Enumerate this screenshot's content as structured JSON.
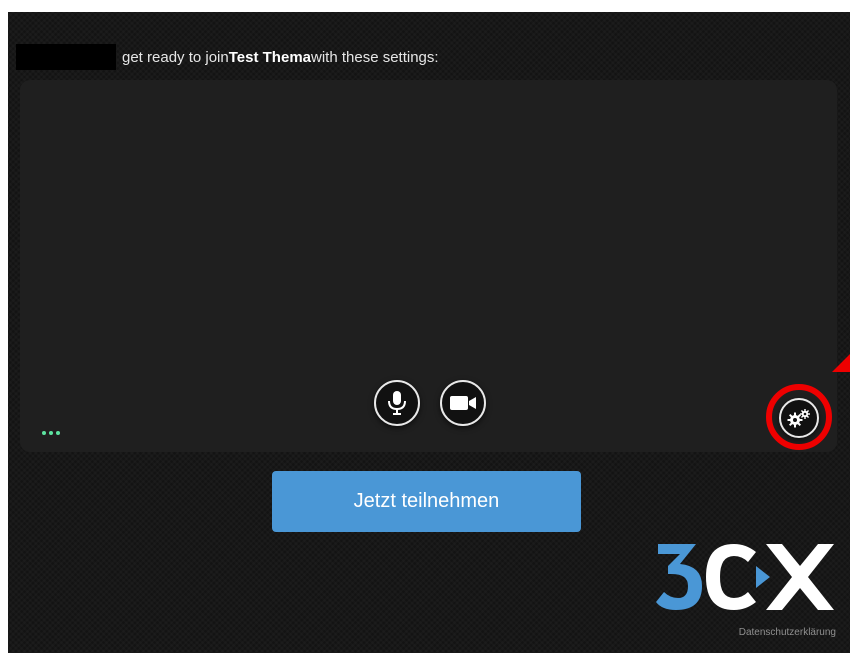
{
  "header": {
    "prefix_text": "get ready to join ",
    "meeting_name": "Test Thema",
    "suffix_text": " with these settings:"
  },
  "preview": {
    "icons": {
      "mic": "microphone-icon",
      "camera": "video-camera-icon",
      "settings": "gears-icon",
      "status": "three-dots-icon"
    },
    "status_color": "#5de3a0"
  },
  "join_button": {
    "label": "Jetzt teilnehmen",
    "color": "#4a97d6"
  },
  "footer": {
    "logo_text": "3CX",
    "privacy_link": "Datenschutzerklärung"
  },
  "annotation": {
    "highlight_color": "#ee0000"
  }
}
